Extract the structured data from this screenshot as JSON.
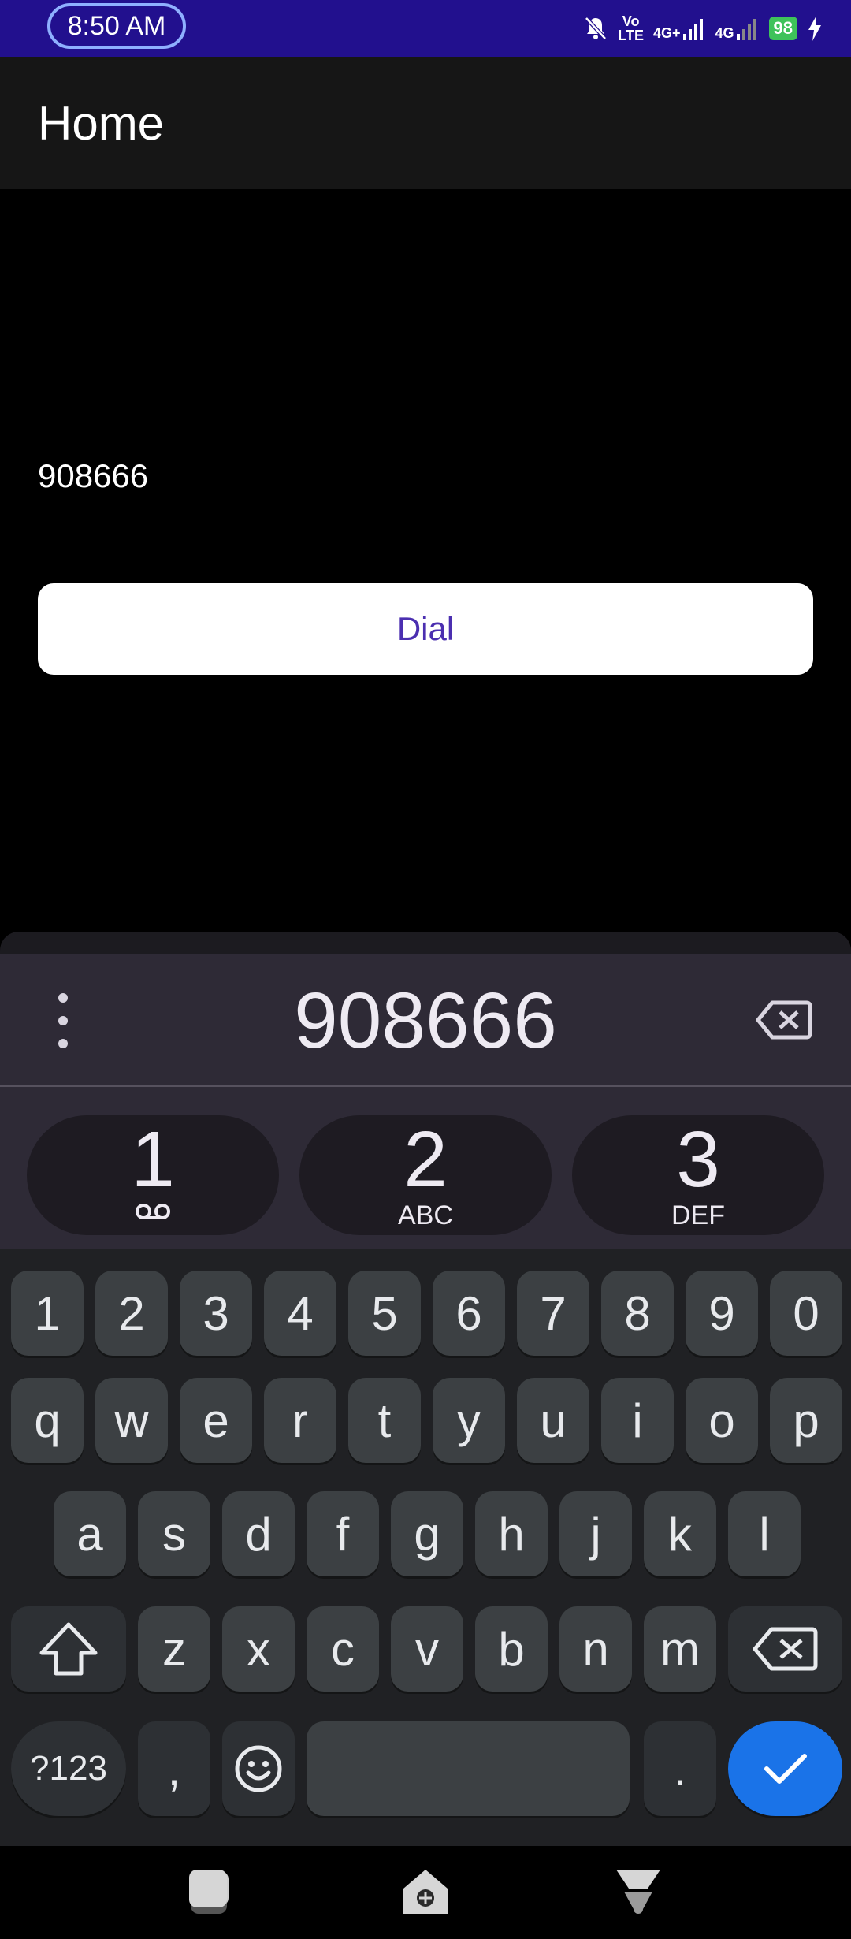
{
  "status_bar": {
    "time": "8:50 AM",
    "volte_top": "Vo",
    "volte_bottom": "LTE",
    "net1": "4G+",
    "net2": "4G",
    "battery": "98"
  },
  "app_bar": {
    "title": "Home"
  },
  "content": {
    "number_text": "908666",
    "dial_label": "Dial"
  },
  "dialer": {
    "number": "908666",
    "keys": [
      {
        "digit": "1",
        "sub": ""
      },
      {
        "digit": "2",
        "sub": "ABC"
      },
      {
        "digit": "3",
        "sub": "DEF"
      }
    ]
  },
  "keyboard": {
    "row_numbers": [
      "1",
      "2",
      "3",
      "4",
      "5",
      "6",
      "7",
      "8",
      "9",
      "0"
    ],
    "row1": [
      "q",
      "w",
      "e",
      "r",
      "t",
      "y",
      "u",
      "i",
      "o",
      "p"
    ],
    "row2": [
      "a",
      "s",
      "d",
      "f",
      "g",
      "h",
      "j",
      "k",
      "l"
    ],
    "row3": [
      "z",
      "x",
      "c",
      "v",
      "b",
      "n",
      "m"
    ],
    "symbols_label": "?123",
    "comma": ",",
    "period": "."
  },
  "colors": {
    "status_bar": "#22108e",
    "dial_text": "#4b2fb0",
    "done_key": "#1a73e8"
  }
}
